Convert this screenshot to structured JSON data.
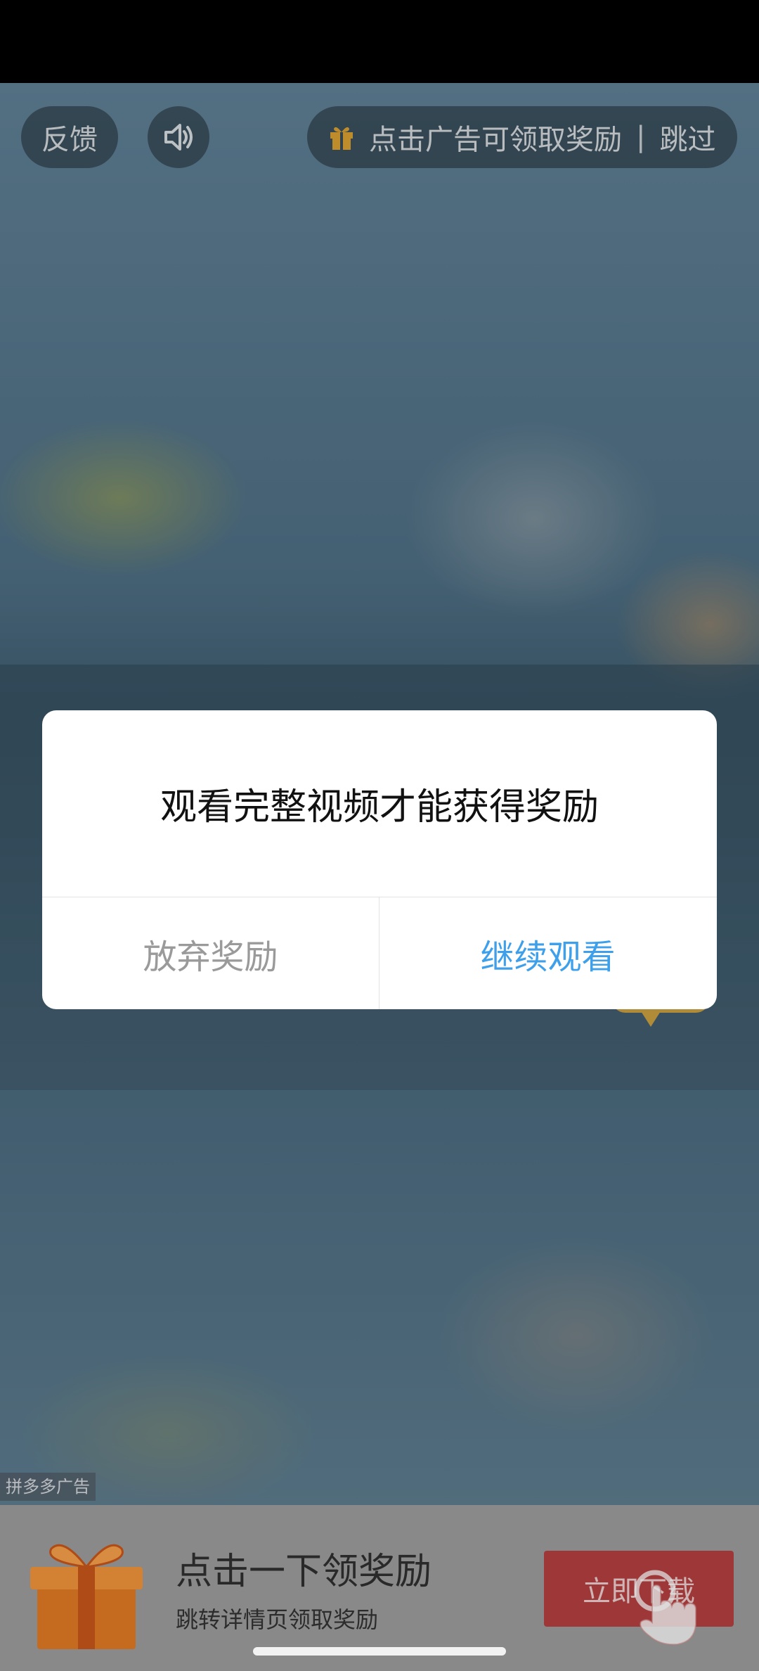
{
  "top_bar": {
    "feedback_label": "反馈",
    "reward_text": "点击广告可领取奖励",
    "divider": "|",
    "skip_label": "跳过"
  },
  "ad": {
    "tag": "拼多多广告",
    "banner_title": "点击一下领奖励",
    "banner_subtitle": "跳转详情页领取奖励",
    "download_label": "立即下载"
  },
  "dialog": {
    "message": "观看完整视频才能获得奖励",
    "abandon_label": "放弃奖励",
    "continue_label": "继续观看"
  },
  "colors": {
    "continue_accent": "#3ea0ea",
    "abandon_text": "#9a9a9a",
    "download_button": "#b44040",
    "gift_orange": "#e8832a"
  },
  "icons": {
    "sound": "speaker-icon",
    "gift": "gift-icon",
    "hand": "pointing-hand-icon"
  }
}
